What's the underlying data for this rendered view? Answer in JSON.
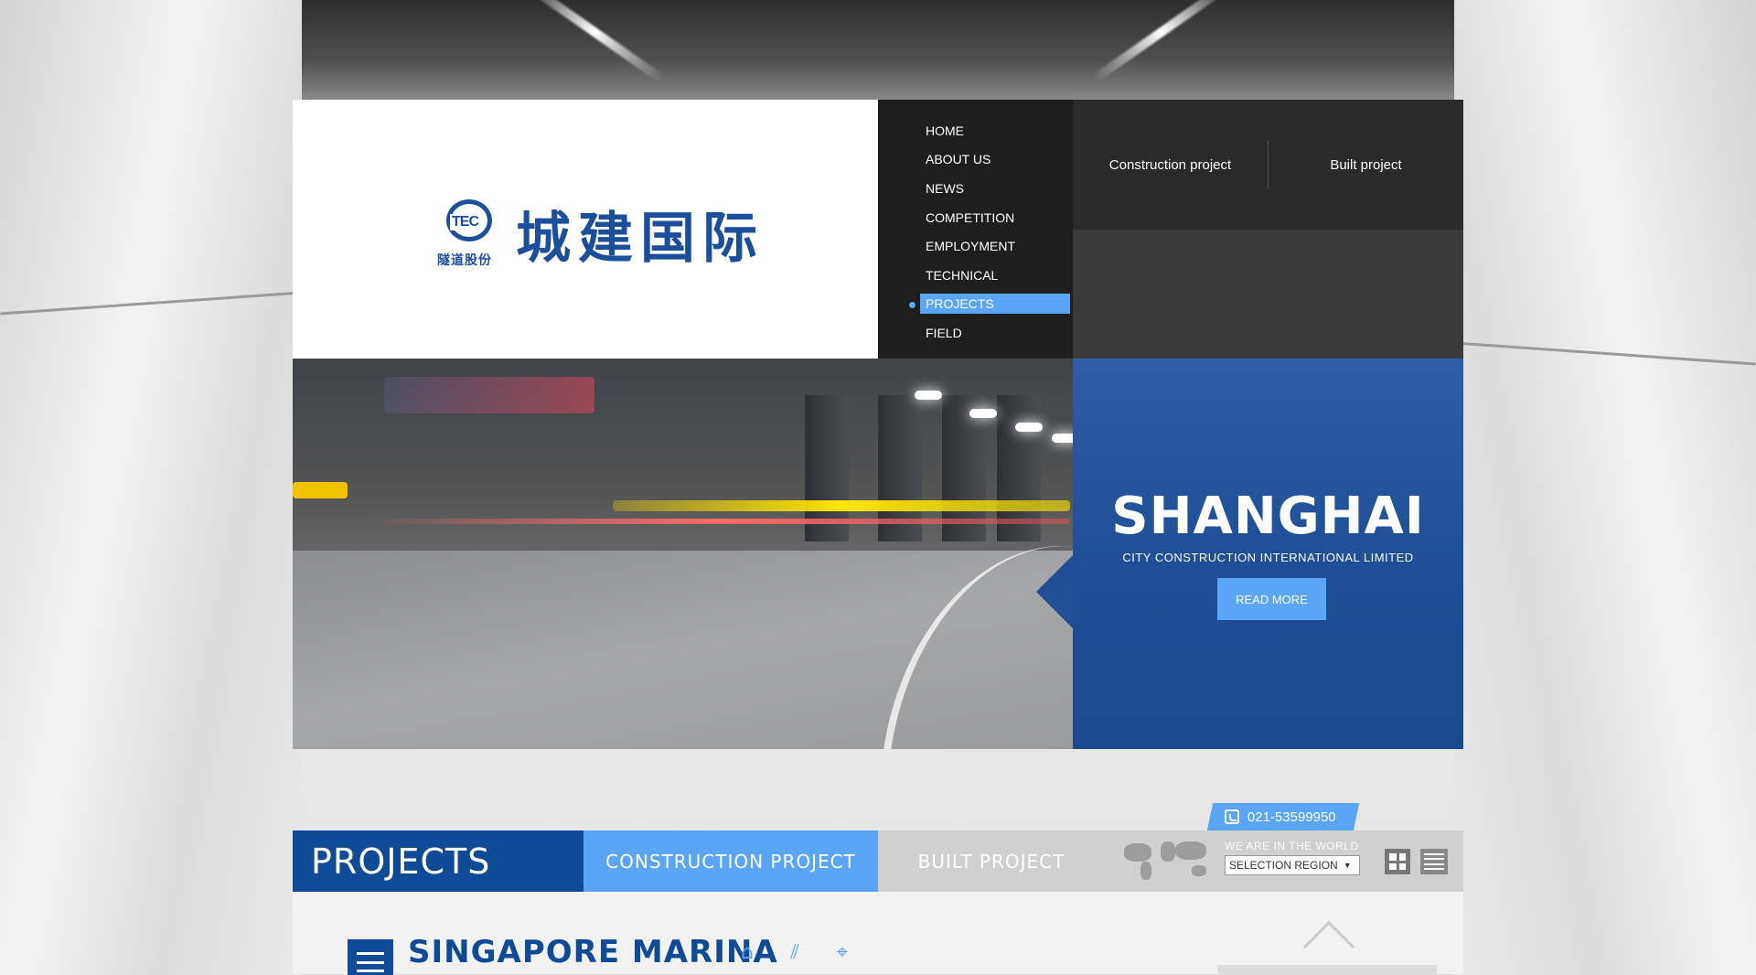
{
  "logo": {
    "mark_text": "TEC",
    "mark_subtext": "隧道股份",
    "name": "城建国际"
  },
  "nav": {
    "items": [
      {
        "label": "HOME"
      },
      {
        "label": "ABOUT US"
      },
      {
        "label": "NEWS"
      },
      {
        "label": "COMPETITION"
      },
      {
        "label": "EMPLOYMENT"
      },
      {
        "label": "TECHNICAL"
      },
      {
        "label": "PROJECTS",
        "active": true
      },
      {
        "label": "FIELD"
      }
    ],
    "sub_links": [
      "Construction project",
      "Built project"
    ]
  },
  "hero": {
    "title": "SHANGHAI",
    "subtitle": "CITY CONSTRUCTION INTERNATIONAL LIMITED",
    "button": "READ MORE"
  },
  "contact": {
    "phone": "021-53599950",
    "icon": "phone-icon"
  },
  "projects_bar": {
    "title": "PROJECTS",
    "tabs": [
      {
        "label": "CONSTRUCTION PROJECT",
        "active": true
      },
      {
        "label": "BUILT PROJECT",
        "active": false
      }
    ],
    "world_label": "WE ARE IN THE WORLD",
    "region_select": "SELECTION REGION",
    "view_icons": [
      "grid-view-icon",
      "list-view-icon"
    ]
  },
  "content": {
    "item_title": "SINGAPORE MARINA",
    "icons": [
      "tunnel-icon",
      "road-icon",
      "map-pin-icon"
    ]
  },
  "colors": {
    "brand_blue": "#0f4a96",
    "accent_blue": "#5aa5f5",
    "menu_dark": "#1e1e1e"
  }
}
